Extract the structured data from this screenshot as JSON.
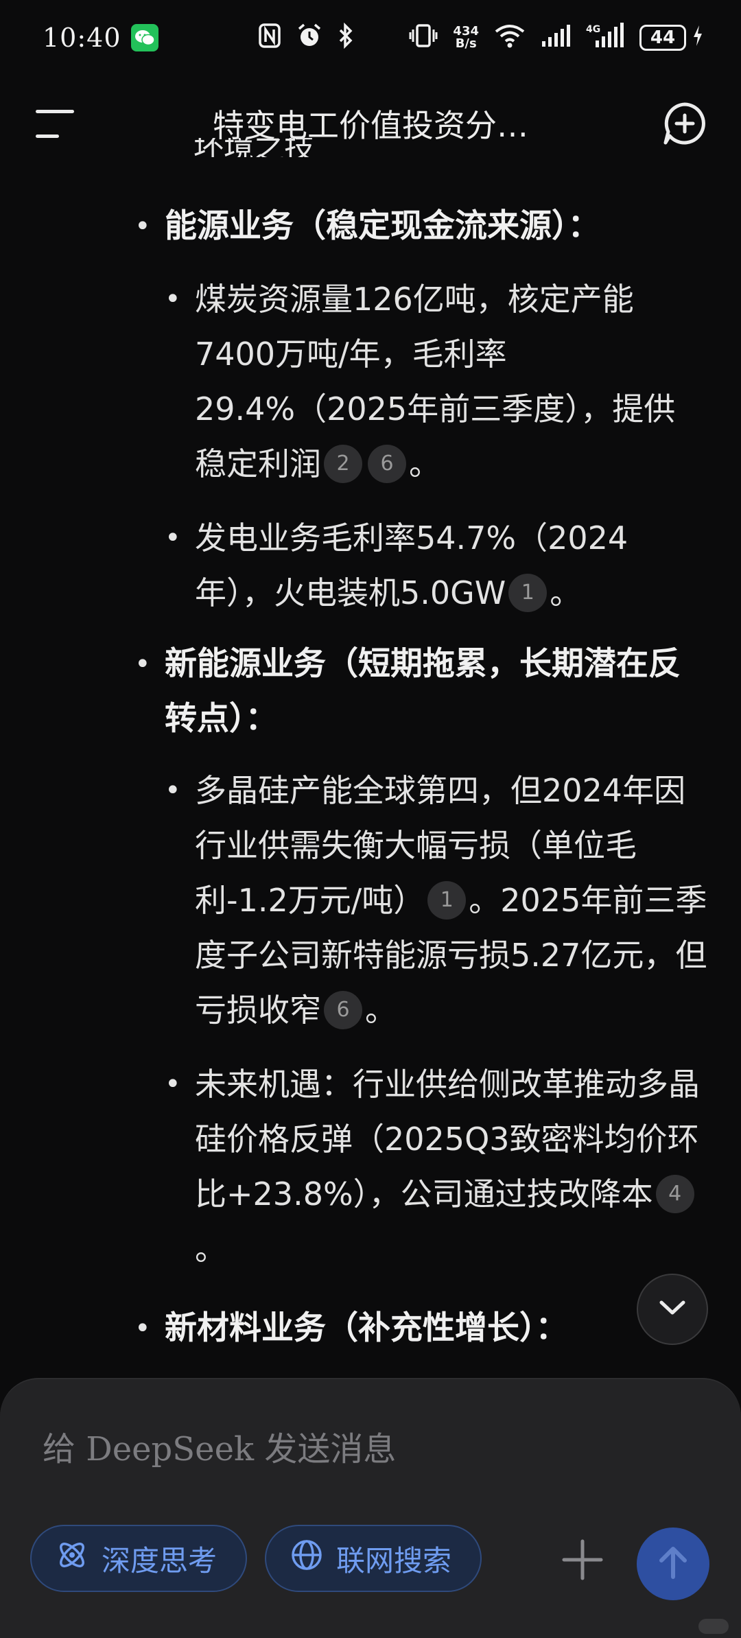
{
  "status_bar": {
    "time": "10:40",
    "net_speed_value": "434",
    "net_speed_unit": "B/s",
    "battery": "44"
  },
  "header": {
    "title": "特变电工价值投资分…"
  },
  "content": {
    "clipped_previous_line": "坏境之技",
    "sections": [
      {
        "heading": "能源业务（稳定现金流来源）：",
        "items": [
          {
            "text": "煤炭资源量126亿吨，核定产能7400万吨/年，毛利率29.4%（2025年前三季度），提供稳定利润",
            "cites": [
              "2",
              "6"
            ],
            "tail": "。"
          },
          {
            "text": "发电业务毛利率54.7%（2024年），火电装机5.0GW",
            "cites": [
              "1"
            ],
            "tail": "。"
          }
        ]
      },
      {
        "heading": "新能源业务（短期拖累，长期潜在反转点）：",
        "items": [
          {
            "text": "多晶硅产能全球第四，但2024年因行业供需失衡大幅亏损（单位毛利-1.2万元/吨）",
            "cites": [
              "1"
            ],
            "tail": "。2025年前三季度子公司新特能源亏损5.27亿元，但亏损收窄",
            "cites2": [
              "6"
            ],
            "tail2": "。"
          },
          {
            "text": "未来机遇：行业供给侧改革推动多晶硅价格反弹（2025Q3致密料均价环比+23.8%），公司通过技改降本",
            "cites": [
              "4"
            ],
            "tail": "。"
          }
        ]
      },
      {
        "heading": "新材料业务（补充性增长）：",
        "items": []
      }
    ],
    "bullet": "•"
  },
  "composer": {
    "placeholder": "给 DeepSeek 发送消息",
    "deep_think_label": "深度思考",
    "web_search_label": "联网搜索"
  },
  "colors": {
    "background": "#0b0b0c",
    "accent": "#6f9cf0",
    "send_button": "#2e4fa1",
    "wechat": "#23c15a"
  },
  "icons": [
    "wechat-icon",
    "nfc-icon",
    "alarm-icon",
    "bluetooth-icon",
    "vibrate-icon",
    "wifi-icon",
    "signal-icon",
    "4g-signal-icon",
    "battery-icon",
    "charging-icon",
    "menu-icon",
    "new-chat-icon",
    "chevron-down-icon",
    "atom-icon",
    "globe-icon",
    "plus-icon",
    "arrow-up-icon"
  ]
}
